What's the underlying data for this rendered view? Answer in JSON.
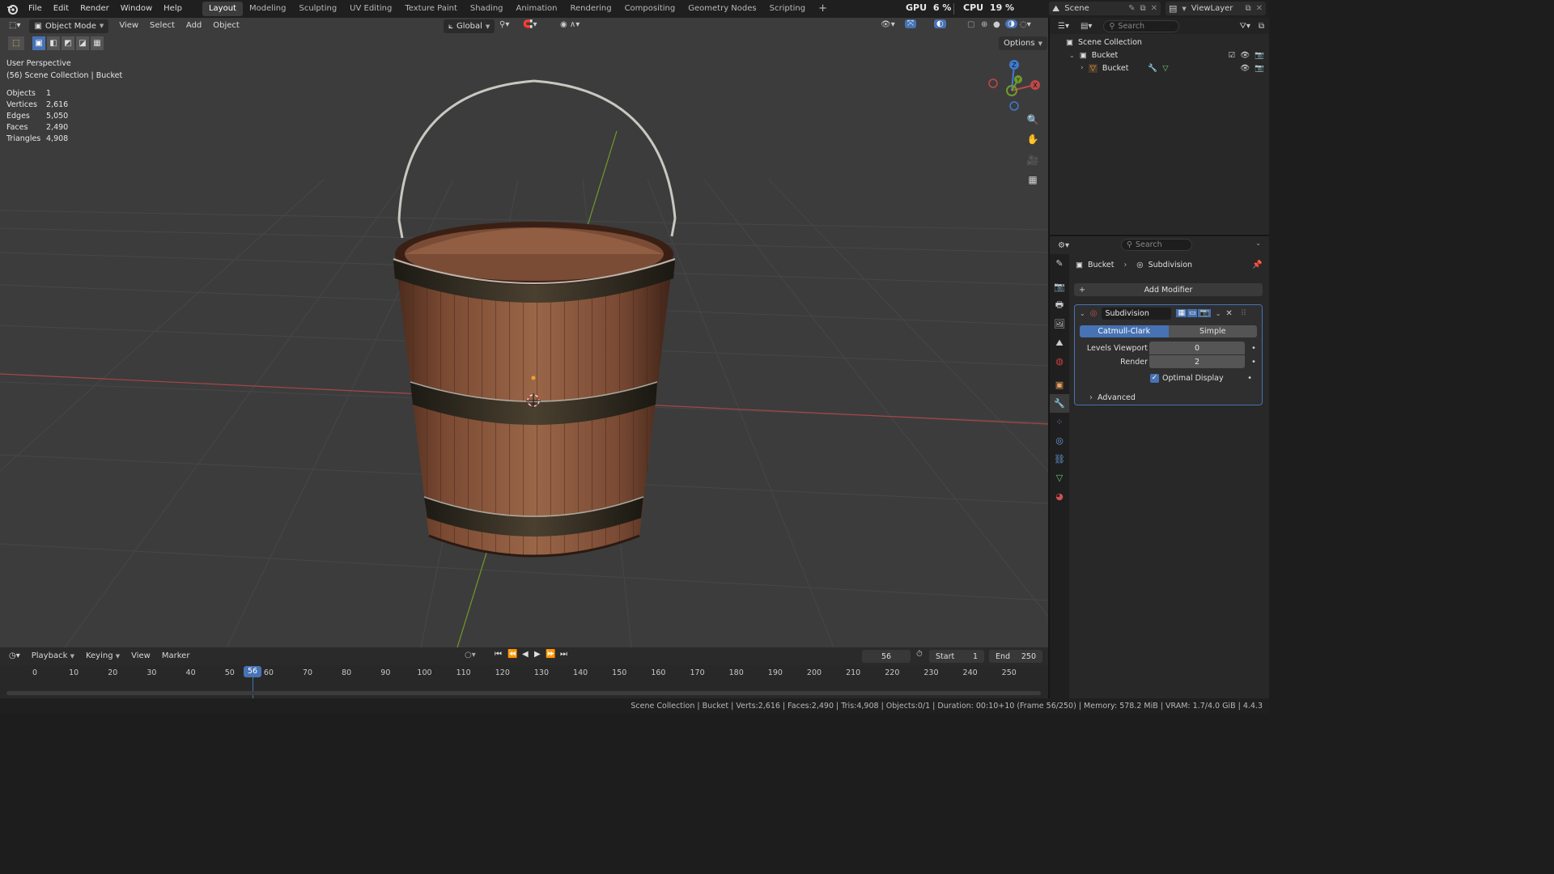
{
  "topbar": {
    "menus": [
      "File",
      "Edit",
      "Render",
      "Window",
      "Help"
    ],
    "workspaces": [
      "Layout",
      "Modeling",
      "Sculpting",
      "UV Editing",
      "Texture Paint",
      "Shading",
      "Animation",
      "Rendering",
      "Compositing",
      "Geometry Nodes",
      "Scripting"
    ],
    "active_workspace": "Layout",
    "add_workspace": "+",
    "gpu_label": "GPU",
    "gpu_value": "6 %",
    "cpu_label": "CPU",
    "cpu_value": "19 %",
    "scene_name": "Scene",
    "view_layer": "ViewLayer"
  },
  "viewport": {
    "mode": "Object Mode",
    "menus": [
      "View",
      "Select",
      "Add",
      "Object"
    ],
    "transform_orientation": "Global",
    "options_label": "Options",
    "perspective": "User Perspective",
    "collection_path": "(56) Scene Collection | Bucket",
    "stats": [
      {
        "label": "Objects",
        "value": "1"
      },
      {
        "label": "Vertices",
        "value": "2,616"
      },
      {
        "label": "Edges",
        "value": "5,050"
      },
      {
        "label": "Faces",
        "value": "2,490"
      },
      {
        "label": "Triangles",
        "value": "4,908"
      }
    ],
    "gizmo": {
      "z": "Z",
      "y": "Y",
      "x": "X"
    }
  },
  "timeline": {
    "menus": [
      "Playback",
      "Keying",
      "View",
      "Marker"
    ],
    "current_frame": "56",
    "start_label": "Start",
    "start_value": "1",
    "end_label": "End",
    "end_value": "250",
    "ruler": [
      "0",
      "10",
      "20",
      "30",
      "40",
      "50",
      "60",
      "70",
      "80",
      "90",
      "100",
      "110",
      "120",
      "130",
      "140",
      "150",
      "160",
      "170",
      "180",
      "190",
      "200",
      "210",
      "220",
      "230",
      "240",
      "250"
    ],
    "playhead_label": "56"
  },
  "outliner": {
    "search_placeholder": "Search",
    "root": "Scene Collection",
    "collection": "Bucket",
    "object": "Bucket"
  },
  "properties": {
    "search_placeholder": "Search",
    "breadcrumb_object": "Bucket",
    "breadcrumb_modifier": "Subdivision",
    "add_modifier": "Add Modifier",
    "modifier_name": "Subdivision",
    "algo_catmull": "Catmull-Clark",
    "algo_simple": "Simple",
    "levels_viewport_label": "Levels Viewport",
    "levels_viewport_value": "0",
    "render_label": "Render",
    "render_value": "2",
    "optimal_display_label": "Optimal Display",
    "advanced_label": "Advanced"
  },
  "statusbar": {
    "text": "Scene Collection | Bucket | Verts:2,616 | Faces:2,490 | Tris:4,908 | Objects:0/1 | Duration: 00:10+10 (Frame 56/250) | Memory: 578.2 MiB | VRAM: 1.7/4.0 GiB | 4.4.3"
  },
  "colors": {
    "accent": "#4772b3",
    "x_axis": "#c04848",
    "y_axis": "#6f9b2a",
    "z_axis": "#3f7ad0",
    "viewport_bg": "#3c3c3c"
  }
}
